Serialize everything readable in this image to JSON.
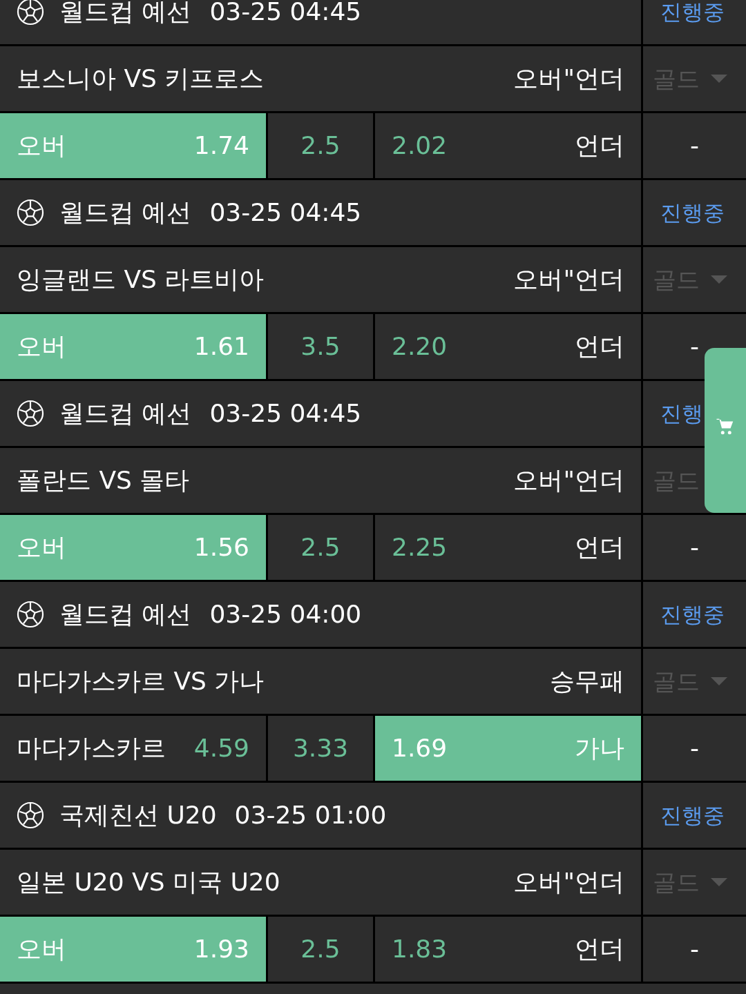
{
  "matches": [
    {
      "league": "월드컵 예선",
      "time": "03-25 04:45",
      "status": "진행중",
      "teams": "보스니아 VS 키프로스",
      "market": "오버\"언더",
      "grade": "골드",
      "grade_arrow": true,
      "home": {
        "label": "오버",
        "odd": "1.74",
        "selected": true
      },
      "middle": "2.5",
      "away": {
        "odd": "2.02",
        "label": "언더",
        "selected": false
      },
      "extra": "-"
    },
    {
      "league": "월드컵 예선",
      "time": "03-25 04:45",
      "status": "진행중",
      "teams": "잉글랜드 VS 라트비아",
      "market": "오버\"언더",
      "grade": "골드",
      "grade_arrow": true,
      "home": {
        "label": "오버",
        "odd": "1.61",
        "selected": true
      },
      "middle": "3.5",
      "away": {
        "odd": "2.20",
        "label": "언더",
        "selected": false
      },
      "extra": "-"
    },
    {
      "league": "월드컵 예선",
      "time": "03-25 04:45",
      "status": "진행",
      "teams": "폴란드 VS 몰타",
      "market": "오버\"언더",
      "grade": "골드",
      "grade_arrow": false,
      "home": {
        "label": "오버",
        "odd": "1.56",
        "selected": true
      },
      "middle": "2.5",
      "away": {
        "odd": "2.25",
        "label": "언더",
        "selected": false
      },
      "extra": "-"
    },
    {
      "league": "월드컵 예선",
      "time": "03-25 04:00",
      "status": "진행중",
      "teams": "마다가스카르 VS 가나",
      "market": "승무패",
      "grade": "골드",
      "grade_arrow": true,
      "home": {
        "label": "마다가스카르",
        "odd": "4.59",
        "selected": false
      },
      "middle": "3.33",
      "away": {
        "odd": "1.69",
        "label": "가나",
        "selected": true
      },
      "extra": "-"
    },
    {
      "league": "국제친선 U20",
      "time": "03-25 01:00",
      "status": "진행중",
      "teams": "일본 U20 VS 미국 U20",
      "market": "오버\"언더",
      "grade": "골드",
      "grade_arrow": true,
      "home": {
        "label": "오버",
        "odd": "1.93",
        "selected": true
      },
      "middle": "2.5",
      "away": {
        "odd": "1.83",
        "label": "언더",
        "selected": false
      },
      "extra": "-"
    }
  ]
}
